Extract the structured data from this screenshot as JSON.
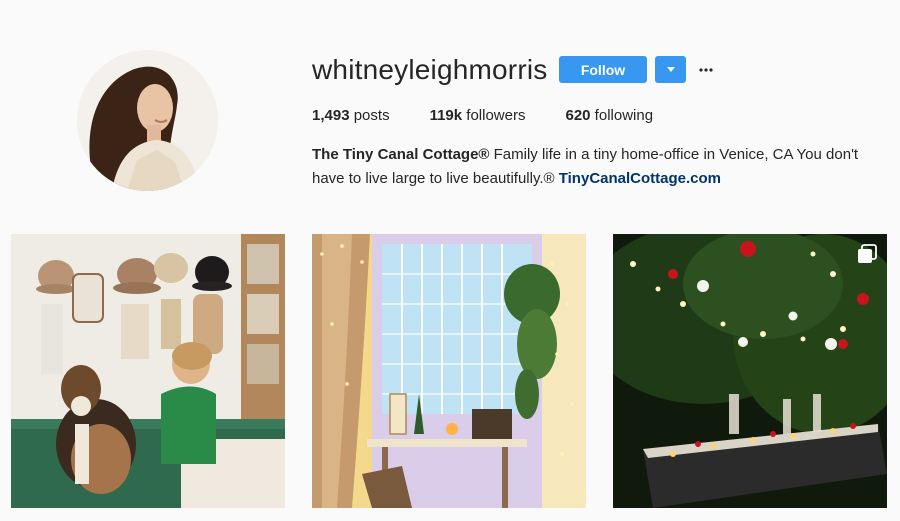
{
  "profile": {
    "username": "whitneyleighmorris",
    "follow_label": "Follow",
    "dropdown_icon": "caret-down-icon",
    "more_icon": "ellipsis-icon",
    "stats": {
      "posts_count": "1,493",
      "posts_label": " posts",
      "followers_count": "119k",
      "followers_label": " followers",
      "following_count": "620",
      "following_label": " following"
    },
    "bio": {
      "full_name": "The Tiny Canal Cottage®",
      "text": " Family life in a tiny home-office in Venice, CA You don't have to live large to live beautifully.® ",
      "link": "TinyCanalCottage.com"
    }
  },
  "posts": [
    {
      "subject": "child-and-beagle-on-bed-with-hats-on-wall"
    },
    {
      "subject": "window-nook-with-string-lights-and-plant"
    },
    {
      "subject": "night-garden-dinner-table-with-lanterns",
      "multi_icon": "carousel-icon"
    }
  ],
  "colors": {
    "accent": "#3897f0",
    "link": "#003569",
    "text": "#262626",
    "background": "#fafafa"
  }
}
